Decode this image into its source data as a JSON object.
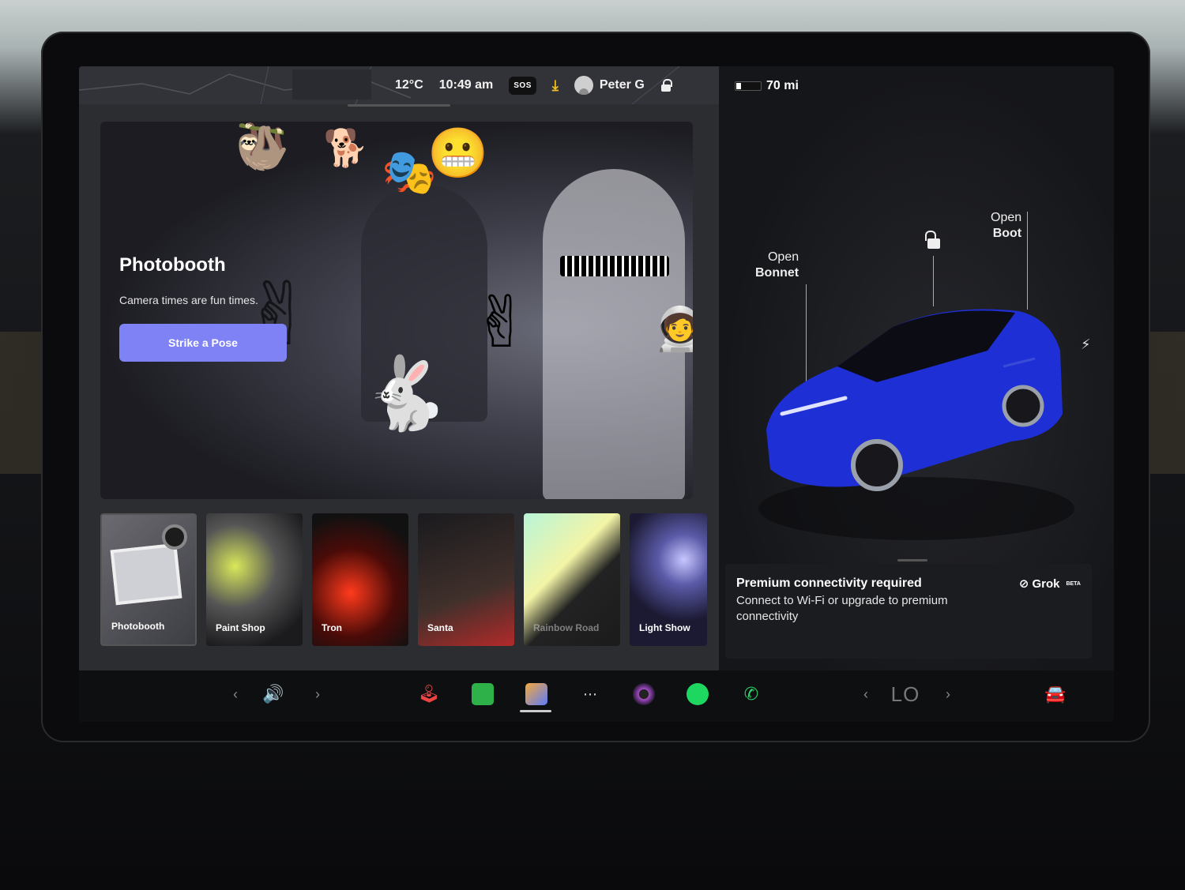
{
  "status": {
    "temperature": "12°C",
    "time": "10:49 am",
    "sos_label": "SOS",
    "user_name": "Peter G"
  },
  "battery": {
    "range": "70 mi"
  },
  "hero": {
    "title": "Photobooth",
    "subtitle": "Camera times are fun times.",
    "button_label": "Strike a Pose"
  },
  "apps": [
    {
      "label": "Photobooth"
    },
    {
      "label": "Paint Shop"
    },
    {
      "label": "Tron"
    },
    {
      "label": "Santa"
    },
    {
      "label": "Rainbow Road"
    },
    {
      "label": "Light Show"
    }
  ],
  "vehicle": {
    "bonnet_label_1": "Open",
    "bonnet_label_2": "Bonnet",
    "boot_label_1": "Open",
    "boot_label_2": "Boot",
    "color": "#1f2fd6"
  },
  "notice": {
    "title": "Premium connectivity required",
    "body": "Connect to Wi-Fi or upgrade to premium connectivity",
    "brand": "Grok",
    "badge": "BETA"
  },
  "dock": {
    "climate_label": "LO",
    "icons": [
      "volume-icon",
      "joystick-icon",
      "chart-app-icon",
      "toybox-icon",
      "more-icon",
      "camera-app-icon",
      "spotify-icon",
      "phone-icon",
      "car-icon"
    ]
  },
  "colors": {
    "accent_button": "#7f82f5",
    "download_icon": "#f4c322",
    "spotify": "#1ed760",
    "phone": "#2bd46a"
  }
}
